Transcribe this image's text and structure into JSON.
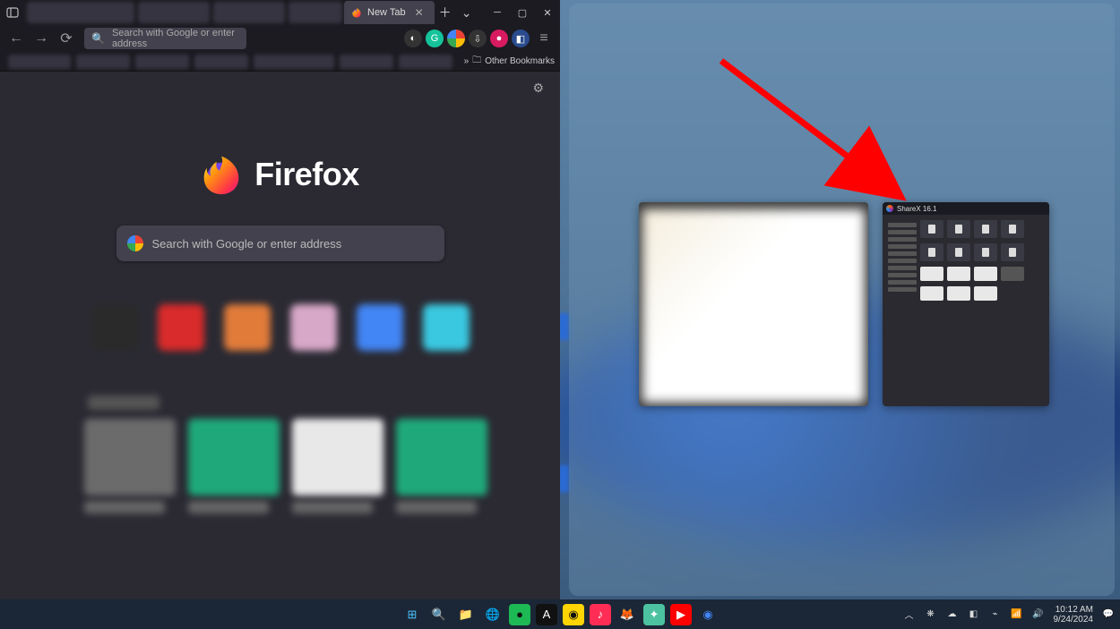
{
  "browser": {
    "tab_title": "New Tab",
    "urlbar_placeholder": "Search with Google or enter address",
    "bookmarks_overflow_label": "Other Bookmarks",
    "brand_text": "Firefox",
    "bigsearch_placeholder": "Search with Google or enter address",
    "shortcut_tiles": [
      {
        "bg": "#2a2a2a"
      },
      {
        "bg": "#d92b2b"
      },
      {
        "bg": "#e07b3a"
      },
      {
        "bg": "#d8a8c8"
      },
      {
        "bg": "#4285f4"
      },
      {
        "bg": "#3ac8e0"
      }
    ],
    "cards": [
      {
        "bg": "#6b6b6b"
      },
      {
        "bg": "#1fa97a"
      },
      {
        "bg": "#e8e8e8"
      },
      {
        "bg": "#1fa97a"
      }
    ],
    "ext_icons": [
      {
        "name": "ext-1",
        "bg": "#333",
        "fg": "#fff",
        "glyph": "◐"
      },
      {
        "name": "ext-grammarly",
        "bg": "#15c39a",
        "fg": "#fff",
        "glyph": "G"
      },
      {
        "name": "ext-google",
        "bg": "conic",
        "fg": "",
        "glyph": ""
      },
      {
        "name": "ext-pocket",
        "bg": "#333",
        "fg": "#ddd",
        "glyph": "⇩"
      },
      {
        "name": "ext-5",
        "bg": "#d81b60",
        "fg": "#fff",
        "glyph": "●"
      },
      {
        "name": "ext-6",
        "bg": "#2a4b8d",
        "fg": "#fff",
        "glyph": "◧"
      }
    ]
  },
  "snap": {
    "thumbB_title": "ShareX 16.1"
  },
  "taskbar": {
    "icons": [
      {
        "name": "start",
        "glyph": "⊞",
        "bg": "",
        "fg": "#4cc2ff"
      },
      {
        "name": "search",
        "glyph": "🔍",
        "bg": "",
        "fg": "#ddd"
      },
      {
        "name": "explorer",
        "glyph": "📁",
        "bg": "",
        "fg": ""
      },
      {
        "name": "edge",
        "glyph": "🌐",
        "bg": "",
        "fg": "#3aa0e0"
      },
      {
        "name": "spotify",
        "glyph": "●",
        "bg": "#1db954",
        "fg": "#111"
      },
      {
        "name": "app-a",
        "glyph": "A",
        "bg": "#111",
        "fg": "#fff"
      },
      {
        "name": "app-y",
        "glyph": "◉",
        "bg": "#ffd400",
        "fg": "#111"
      },
      {
        "name": "music",
        "glyph": "♪",
        "bg": "#ff2d55",
        "fg": "#fff"
      },
      {
        "name": "firefox",
        "glyph": "🦊",
        "bg": "",
        "fg": ""
      },
      {
        "name": "app-s",
        "glyph": "✦",
        "bg": "#4cc2a0",
        "fg": "#fff"
      },
      {
        "name": "youtube",
        "glyph": "▶",
        "bg": "#ff0000",
        "fg": "#fff"
      },
      {
        "name": "chrome",
        "glyph": "◉",
        "bg": "",
        "fg": "#4285f4"
      }
    ],
    "tray": {
      "time": "10:12 AM",
      "date": "9/24/2024"
    }
  }
}
